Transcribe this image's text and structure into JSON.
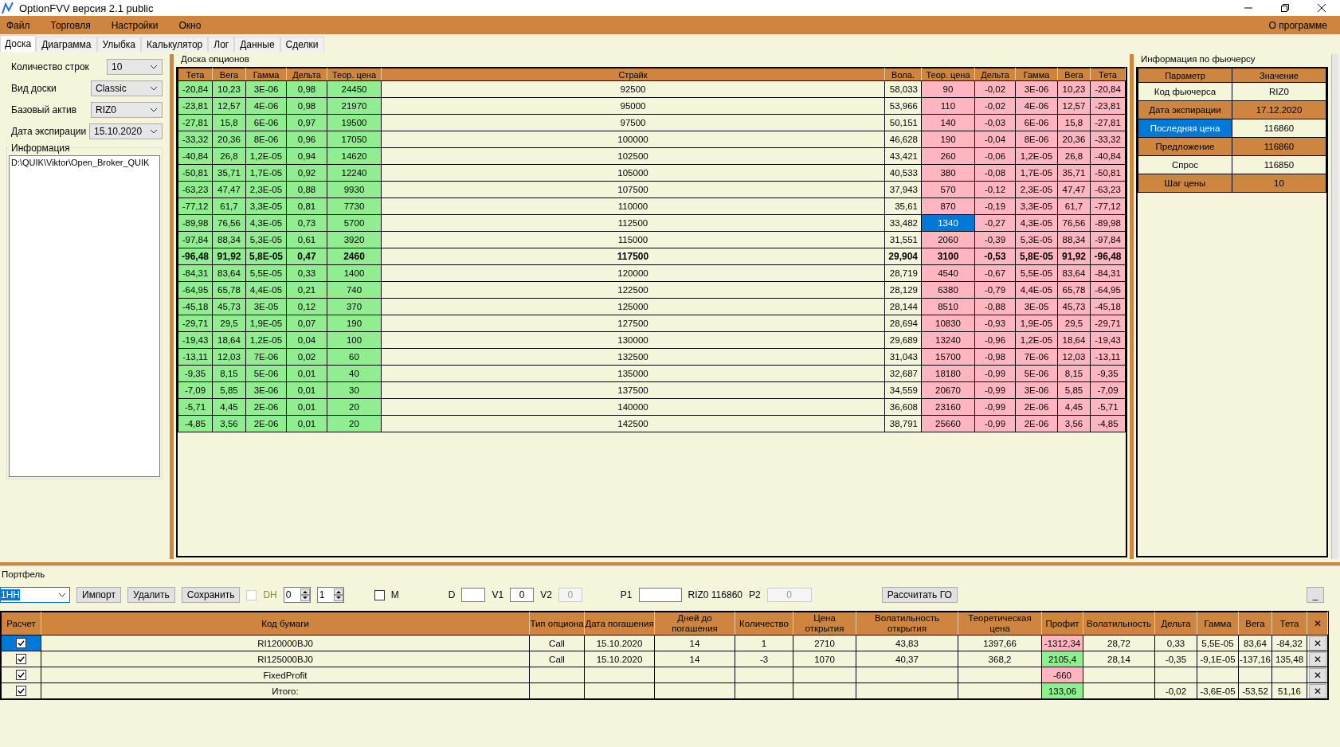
{
  "window": {
    "title": "OptionFVV версия 2.1 public"
  },
  "menu": {
    "items": [
      "Файл",
      "Торговля",
      "Настройки",
      "Окно"
    ],
    "about": "О программе"
  },
  "tabs": [
    {
      "label": "Доска",
      "selected": true
    },
    {
      "label": "Диаграмма",
      "selected": false
    },
    {
      "label": "Улыбка",
      "selected": false
    },
    {
      "label": "Калькулятор",
      "selected": false
    },
    {
      "label": "Лог",
      "selected": false
    },
    {
      "label": "Данные",
      "selected": false
    },
    {
      "label": "Сделки",
      "selected": false
    }
  ],
  "settings": [
    {
      "label": "Количество строк",
      "value": "10"
    },
    {
      "label": "Вид доски",
      "value": "Classic"
    },
    {
      "label": "Базовый актив",
      "value": "RIZ0"
    },
    {
      "label": "Дата экспирации",
      "value": "15.10.2020"
    }
  ],
  "info": {
    "title": "Информация",
    "text": "D:\\QUIK\\Viktor\\Open_Broker_QUIK"
  },
  "board": {
    "title": "Доска опционов",
    "columns": [
      "Тета",
      "Вега",
      "Гамма",
      "Дельта",
      "Теор. цена",
      "Страйк",
      "Вола.",
      "Теор. цена",
      "Дельта",
      "Гамма",
      "Вега",
      "Тета"
    ],
    "rows": [
      {
        "cells": [
          "-20,84",
          "10,23",
          "3E-06",
          "0,98",
          "24450",
          "92500",
          "58,033",
          "90",
          "-0,02",
          "3E-06",
          "10,23",
          "-20,84"
        ],
        "atm": false,
        "selected": false
      },
      {
        "cells": [
          "-23,81",
          "12,57",
          "4E-06",
          "0,98",
          "21970",
          "95000",
          "53,966",
          "110",
          "-0,02",
          "4E-06",
          "12,57",
          "-23,81"
        ],
        "atm": false,
        "selected": false
      },
      {
        "cells": [
          "-27,81",
          "15,8",
          "6E-06",
          "0,97",
          "19500",
          "97500",
          "50,151",
          "140",
          "-0,03",
          "6E-06",
          "15,8",
          "-27,81"
        ],
        "atm": false,
        "selected": false
      },
      {
        "cells": [
          "-33,32",
          "20,36",
          "8E-06",
          "0,96",
          "17050",
          "100000",
          "46,628",
          "190",
          "-0,04",
          "8E-06",
          "20,36",
          "-33,32"
        ],
        "atm": false,
        "selected": false
      },
      {
        "cells": [
          "-40,84",
          "26,8",
          "1,2E-05",
          "0,94",
          "14620",
          "102500",
          "43,421",
          "260",
          "-0,06",
          "1,2E-05",
          "26,8",
          "-40,84"
        ],
        "atm": false,
        "selected": false
      },
      {
        "cells": [
          "-50,81",
          "35,71",
          "1,7E-05",
          "0,92",
          "12240",
          "105000",
          "40,533",
          "380",
          "-0,08",
          "1,7E-05",
          "35,71",
          "-50,81"
        ],
        "atm": false,
        "selected": false
      },
      {
        "cells": [
          "-63,23",
          "47,47",
          "2,3E-05",
          "0,88",
          "9930",
          "107500",
          "37,943",
          "570",
          "-0,12",
          "2,3E-05",
          "47,47",
          "-63,23"
        ],
        "atm": false,
        "selected": false
      },
      {
        "cells": [
          "-77,12",
          "61,7",
          "3,3E-05",
          "0,81",
          "7730",
          "110000",
          "35,61",
          "870",
          "-0,19",
          "3,3E-05",
          "61,7",
          "-77,12"
        ],
        "atm": false,
        "selected": false
      },
      {
        "cells": [
          "-89,98",
          "76,56",
          "4,3E-05",
          "0,73",
          "5700",
          "112500",
          "33,482",
          "1340",
          "-0,27",
          "4,3E-05",
          "76,56",
          "-89,98"
        ],
        "atm": false,
        "selected": true
      },
      {
        "cells": [
          "-97,84",
          "88,34",
          "5,3E-05",
          "0,61",
          "3920",
          "115000",
          "31,551",
          "2060",
          "-0,39",
          "5,3E-05",
          "88,34",
          "-97,84"
        ],
        "atm": false,
        "selected": false
      },
      {
        "cells": [
          "-96,48",
          "91,92",
          "5,8E-05",
          "0,47",
          "2460",
          "117500",
          "29,904",
          "3100",
          "-0,53",
          "5,8E-05",
          "91,92",
          "-96,48"
        ],
        "atm": true,
        "selected": false
      },
      {
        "cells": [
          "-84,31",
          "83,64",
          "5,5E-05",
          "0,33",
          "1400",
          "120000",
          "28,719",
          "4540",
          "-0,67",
          "5,5E-05",
          "83,64",
          "-84,31"
        ],
        "atm": false,
        "selected": false
      },
      {
        "cells": [
          "-64,95",
          "65,78",
          "4,4E-05",
          "0,21",
          "740",
          "122500",
          "28,129",
          "6380",
          "-0,79",
          "4,4E-05",
          "65,78",
          "-64,95"
        ],
        "atm": false,
        "selected": false
      },
      {
        "cells": [
          "-45,18",
          "45,73",
          "3E-05",
          "0,12",
          "370",
          "125000",
          "28,144",
          "8510",
          "-0,88",
          "3E-05",
          "45,73",
          "-45,18"
        ],
        "atm": false,
        "selected": false
      },
      {
        "cells": [
          "-29,71",
          "29,5",
          "1,9E-05",
          "0,07",
          "190",
          "127500",
          "28,694",
          "10830",
          "-0,93",
          "1,9E-05",
          "29,5",
          "-29,71"
        ],
        "atm": false,
        "selected": false
      },
      {
        "cells": [
          "-19,43",
          "18,64",
          "1,2E-05",
          "0,04",
          "100",
          "130000",
          "29,689",
          "13240",
          "-0,96",
          "1,2E-05",
          "18,64",
          "-19,43"
        ],
        "atm": false,
        "selected": false
      },
      {
        "cells": [
          "-13,11",
          "12,03",
          "7E-06",
          "0,02",
          "60",
          "132500",
          "31,043",
          "15700",
          "-0,98",
          "7E-06",
          "12,03",
          "-13,11"
        ],
        "atm": false,
        "selected": false
      },
      {
        "cells": [
          "-9,35",
          "8,15",
          "5E-06",
          "0,01",
          "40",
          "135000",
          "32,687",
          "18180",
          "-0,99",
          "5E-06",
          "8,15",
          "-9,35"
        ],
        "atm": false,
        "selected": false
      },
      {
        "cells": [
          "-7,09",
          "5,85",
          "3E-06",
          "0,01",
          "30",
          "137500",
          "34,559",
          "20670",
          "-0,99",
          "3E-06",
          "5,85",
          "-7,09"
        ],
        "atm": false,
        "selected": false
      },
      {
        "cells": [
          "-5,71",
          "4,45",
          "2E-06",
          "0,01",
          "20",
          "140000",
          "36,608",
          "23160",
          "-0,99",
          "2E-06",
          "4,45",
          "-5,71"
        ],
        "atm": false,
        "selected": false
      },
      {
        "cells": [
          "-4,85",
          "3,56",
          "2E-06",
          "0,01",
          "20",
          "142500",
          "38,791",
          "25660",
          "-0,99",
          "2E-06",
          "3,56",
          "-4,85"
        ],
        "atm": false,
        "selected": false
      }
    ]
  },
  "futures": {
    "title": "Информация по фьючерсу",
    "columns": [
      "Параметр",
      "Значение"
    ],
    "rows": [
      {
        "param": "Код фьючерса",
        "value": "RIZ0",
        "selected": false
      },
      {
        "param": "Дата экспирации",
        "value": "17.12.2020",
        "selected": false
      },
      {
        "param": "Последняя цена",
        "value": "116860",
        "selected": true
      },
      {
        "param": "Предложение",
        "value": "116860",
        "selected": false
      },
      {
        "param": "Спрос",
        "value": "116850",
        "selected": false
      },
      {
        "param": "Шаг цены",
        "value": "10",
        "selected": false
      }
    ]
  },
  "portfolio": {
    "title": "Портфель",
    "toolbar": {
      "portfolio_value": "1НН",
      "buttons": [
        "Импорт",
        "Удалить",
        "Сохранить"
      ],
      "dh": {
        "label": "DH",
        "checked": false,
        "disabled": true
      },
      "spin1": "0",
      "spin2": "1",
      "m": {
        "label": "M",
        "checked": false
      },
      "d_label": "D",
      "v1_label": "V1",
      "v1": "0",
      "v2_label": "V2",
      "v2": "0",
      "p1_label": "P1",
      "futures_price": "RIZ0 116860",
      "p2_label": "P2",
      "p2": "0",
      "calc_button": "Рассчитать ГО",
      "minimize_button": "_"
    },
    "columns": [
      "Расчет",
      "Код бумаги",
      "Тип опциона",
      "Дата погашения",
      "Дней до погашения",
      "Количество",
      "Цена открытия",
      "Волатильность открытия",
      "Теоретическая цена",
      "Профит",
      "Волатильность",
      "Дельта",
      "Гамма",
      "Вега",
      "Тета",
      "✕"
    ],
    "rows": [
      {
        "checked": true,
        "selected": true,
        "profit_negative": true,
        "cells": [
          null,
          "RI120000BJ0",
          "Call",
          "15.10.2020",
          "14",
          "1",
          "2710",
          "43,83",
          "1397,66",
          "-1312,34",
          "28,72",
          "0,33",
          "5,5E-05",
          "83,64",
          "-84,32"
        ],
        "remove": "✕"
      },
      {
        "checked": true,
        "selected": false,
        "profit_negative": false,
        "cells": [
          null,
          "RI125000BJ0",
          "Call",
          "15.10.2020",
          "14",
          "-3",
          "1070",
          "40,37",
          "368,2",
          "2105,4",
          "28,14",
          "-0,35",
          "-9,1E-05",
          "-137,16",
          "135,48"
        ],
        "remove": "✕"
      },
      {
        "checked": true,
        "selected": false,
        "profit_negative": true,
        "cells": [
          null,
          "FixedProfit",
          null,
          null,
          null,
          null,
          null,
          null,
          null,
          "-660",
          null,
          null,
          null,
          null,
          null
        ],
        "remove": "✕"
      },
      {
        "checked": true,
        "selected": false,
        "profit_negative": false,
        "cells": [
          null,
          "Итого:",
          null,
          null,
          null,
          null,
          null,
          null,
          null,
          "133,06",
          null,
          "-0,02",
          "-3,6E-05",
          "-53,52",
          "51,16"
        ],
        "remove": "✕"
      }
    ]
  }
}
